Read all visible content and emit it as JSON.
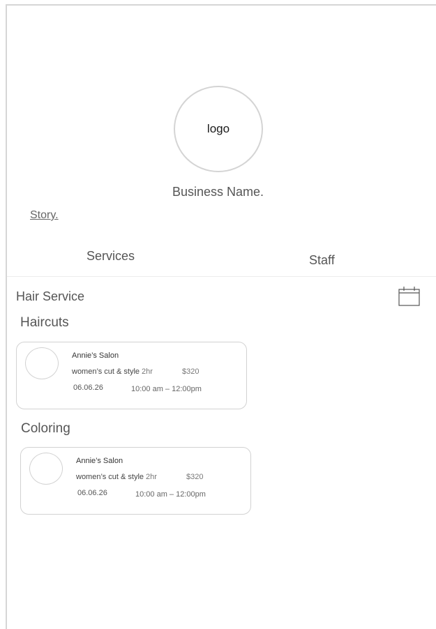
{
  "profile": {
    "logo_text": "logo",
    "business_name": "Business Name.",
    "story_link": "Story."
  },
  "tabs": [
    {
      "label": "Services"
    },
    {
      "label": "Staff"
    }
  ],
  "section": {
    "title": "Hair Service",
    "calendar_icon": "calendar-icon"
  },
  "categories": [
    {
      "title": "Haircuts",
      "booking": {
        "salon": "Annie’s Salon",
        "service": "women’s cut & style",
        "duration": "2hr",
        "price": "$320",
        "date": "06.06.26",
        "time": "10:00 am – 12:00pm"
      }
    },
    {
      "title": "Coloring",
      "booking": {
        "salon": "Annie’s Salon",
        "service": "women’s cut & style",
        "duration": "2hr",
        "price": "$320",
        "date": "06.06.26",
        "time": "10:00 am – 12:00pm"
      }
    }
  ],
  "colors": {
    "border": "#d2d2d2",
    "text": "#555555",
    "background": "#ffffff"
  }
}
